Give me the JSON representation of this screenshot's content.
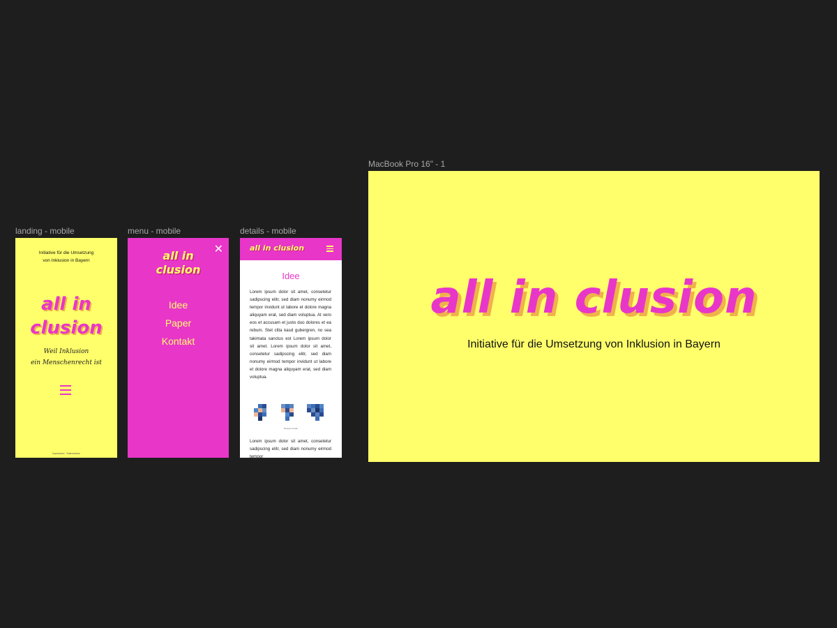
{
  "frames": {
    "landing_label": "landing - mobile",
    "menu_label": "menu - mobile",
    "details_label": "details - mobile",
    "desktop_label": "MacBook Pro 16\" - 1"
  },
  "landing": {
    "tagline_line1": "Initiative für die Umsetzung",
    "tagline_line2": "von Inklusion in Bayern",
    "logo_line1": "all in",
    "logo_line2": "clusion",
    "slogan_line1": "Weil Inklusion",
    "slogan_line2": "ein Menschenrecht ist",
    "menu_icon": "hamburger-icon",
    "footer": "Impressum · Datenschutz"
  },
  "menu": {
    "close_icon": "close-icon",
    "close_glyph": "✕",
    "logo_line1": "all in",
    "logo_line2": "clusion",
    "items": [
      "Idee",
      "Paper",
      "Kontakt"
    ]
  },
  "details": {
    "header_logo": "all in clusion",
    "menu_icon": "hamburger-icon",
    "heading": "Idee",
    "paragraph1": "Lorem ipsum dolor sit amet, consetetur sadipscing elitr, sed diam nonumy eirmod tempor invidunt ut labore et dolore magna aliquyam erat, sed diam voluptua. At vero eos et accusam et justo duo dolores et ea rebum. Stet clita kasd gubergren, no sea takimata sanctus est Lorem ipsum dolor sit amet. Lorem ipsum dolor sit amet, consetetur sadipscing elitr, sed diam nonumy eirmod tempor invidunt ut labore et dolore magna aliquyam erat, sed diam voluptua.",
    "caption": "Beispiel-Grafik",
    "paragraph2": "Lorem ipsum dolor sit amet, consetetur sadipscing elitr, sed diam nonumy eirmod tempor"
  },
  "desktop": {
    "logo": "all in clusion",
    "tagline": "Initiative für die Umsetzung von Inklusion in Bayern"
  },
  "colors": {
    "background": "#1e1e1e",
    "yellow": "#ffff6b",
    "pink": "#e836c9",
    "shadow": "#f0b24a"
  }
}
